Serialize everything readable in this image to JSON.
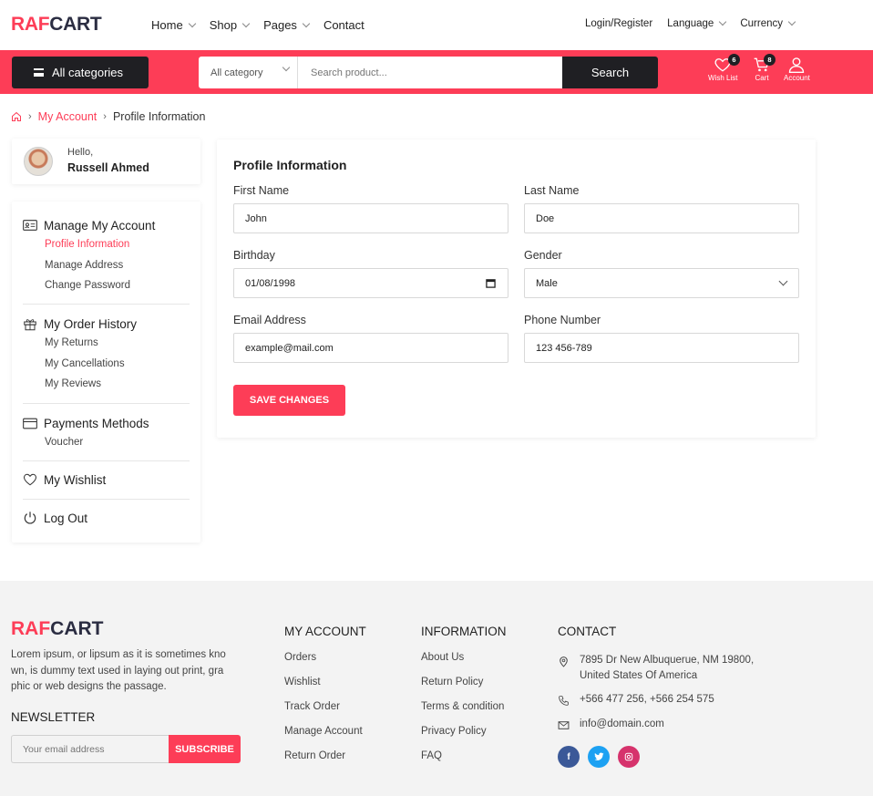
{
  "brand": {
    "part1": "RAF",
    "part2": "CART"
  },
  "nav": {
    "items": [
      {
        "label": "Home",
        "dropdown": true
      },
      {
        "label": "Shop",
        "dropdown": true
      },
      {
        "label": "Pages",
        "dropdown": true
      },
      {
        "label": "Contact",
        "dropdown": false
      }
    ],
    "login": "Login/Register",
    "language": "Language",
    "currency": "Currency"
  },
  "searchbar": {
    "all_categories": "All categories",
    "category_select": "All category",
    "placeholder": "Search product...",
    "button": "Search"
  },
  "header_icons": {
    "wishlist": {
      "label": "Wish List",
      "count": "6"
    },
    "cart": {
      "label": "Cart",
      "count": "8"
    },
    "account": {
      "label": "Account"
    }
  },
  "breadcrumb": {
    "parent": "My Account",
    "current": "Profile Information"
  },
  "user": {
    "greeting": "Hello,",
    "name": "Russell Ahmed"
  },
  "sidebar": {
    "manage": {
      "title": "Manage My Account",
      "items": [
        "Profile Information",
        "Manage Address",
        "Change Password"
      ]
    },
    "orders": {
      "title": "My Order History",
      "items": [
        "My Returns",
        "My Cancellations",
        "My Reviews"
      ]
    },
    "payments": {
      "title": "Payments Methods",
      "items": [
        "Voucher"
      ]
    },
    "wishlist": "My Wishlist",
    "logout": "Log Out"
  },
  "form": {
    "title": "Profile Information",
    "first_name": {
      "label": "First Name",
      "value": "John"
    },
    "last_name": {
      "label": "Last Name",
      "value": "Doe"
    },
    "birthday": {
      "label": "Birthday",
      "value": "01/08/1998"
    },
    "gender": {
      "label": "Gender",
      "value": "Male"
    },
    "email": {
      "label": "Email Address",
      "value": "example@mail.com"
    },
    "phone": {
      "label": "Phone Number",
      "value": "123 456-789"
    },
    "save": "SAVE CHANGES"
  },
  "footer": {
    "description": "Lorem ipsum, or lipsum as it is sometimes kno wn, is dummy text used in laying out print, gra phic or web designs the passage.",
    "newsletter": {
      "title": "NEWSLETTER",
      "placeholder": "Your email address",
      "button": "SUBSCRIBE"
    },
    "my_account": {
      "title": "MY ACCOUNT",
      "links": [
        "Orders",
        "Wishlist",
        "Track Order",
        "Manage Account",
        "Return Order"
      ]
    },
    "information": {
      "title": "INFORMATION",
      "links": [
        "About Us",
        "Return Policy",
        "Terms & condition",
        "Privacy Policy",
        "FAQ"
      ]
    },
    "contact": {
      "title": "CONTACT",
      "address_line1": "7895 Dr New Albuquerue, NM 19800,",
      "address_line2": "United States Of America",
      "phone": "+566 477 256, +566 254 575",
      "email": "info@domain.com"
    },
    "social": [
      "facebook-icon",
      "twitter-icon",
      "instagram-icon"
    ]
  },
  "colors": {
    "accent": "#fd3d57",
    "dark": "#1f1f23",
    "footer_bg": "#f3f3f3"
  }
}
